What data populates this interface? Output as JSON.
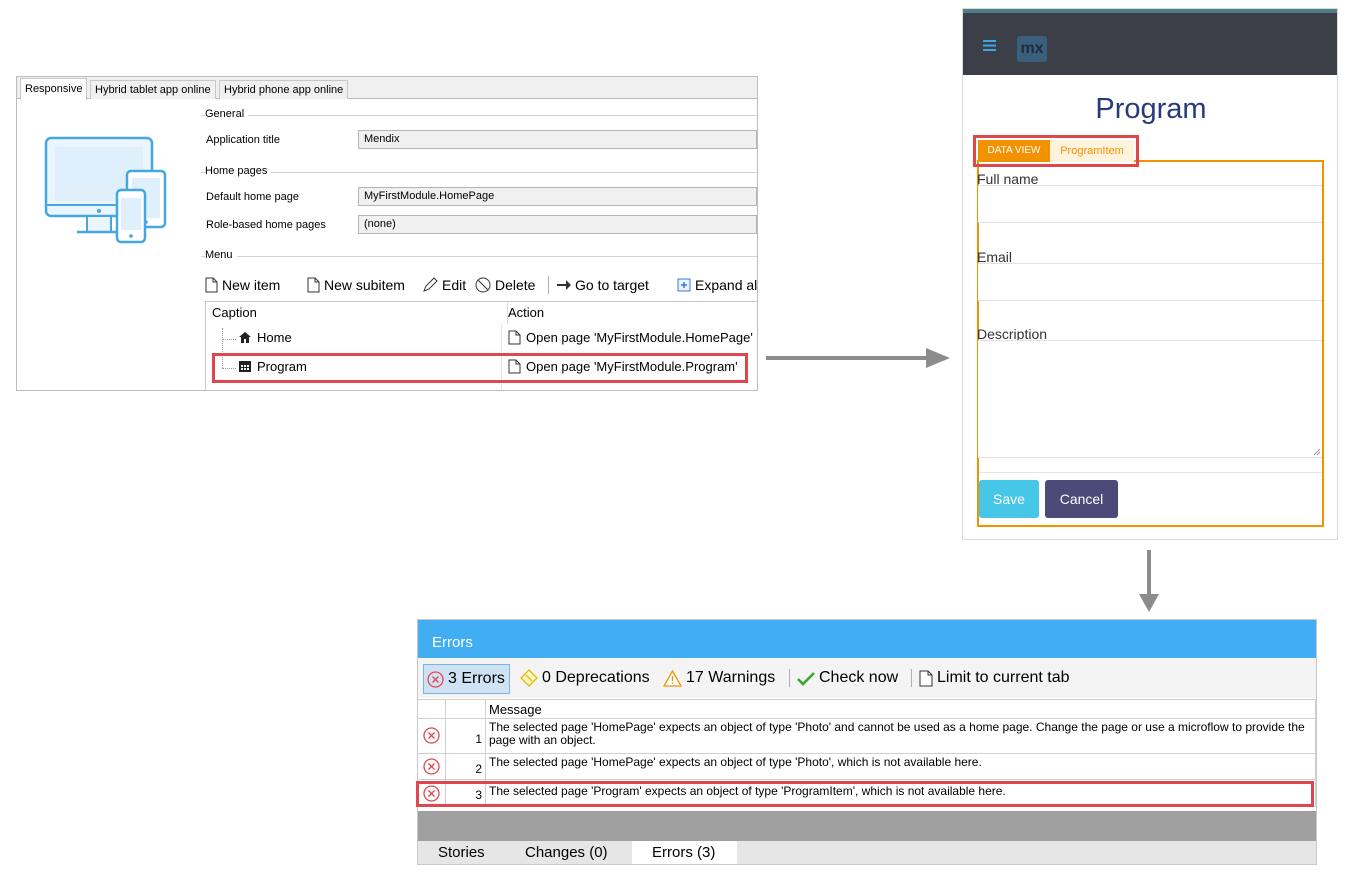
{
  "navigation": {
    "tabs": [
      "Responsive",
      "Hybrid tablet app online",
      "Hybrid phone app online"
    ],
    "general": {
      "label": "General",
      "app_title_label": "Application title",
      "app_title_value": "Mendix"
    },
    "home_pages": {
      "label": "Home pages",
      "default_label": "Default home page",
      "default_value": "MyFirstModule.HomePage",
      "role_label": "Role-based home pages",
      "role_value": "(none)"
    },
    "menu": {
      "label": "Menu",
      "toolbar": {
        "new_item": "New item",
        "new_subitem": "New subitem",
        "edit": "Edit",
        "delete": "Delete",
        "go_to_target": "Go to target",
        "expand_all": "Expand all"
      },
      "columns": [
        "Caption",
        "Action"
      ],
      "rows": [
        {
          "caption": "Home",
          "action": "Open page 'MyFirstModule.HomePage'"
        },
        {
          "caption": "Program",
          "action": "Open page 'MyFirstModule.Program'"
        }
      ]
    }
  },
  "preview": {
    "menu_icon": "hamburger-icon",
    "logo_text": "mx",
    "title": "Program",
    "dataview_tag": "DATA VIEW",
    "dataview_entity": "ProgramItem",
    "fields": [
      {
        "label": "Full name"
      },
      {
        "label": "Email"
      },
      {
        "label": "Description"
      }
    ],
    "save_label": "Save",
    "cancel_label": "Cancel",
    "colors": {
      "accent": "#f39200",
      "save": "#47c7e8",
      "cancel": "#4c4a78",
      "heading": "#273b7a"
    }
  },
  "errors": {
    "title": "Errors",
    "toolbar": {
      "errors": "3 Errors",
      "deprecations": "0 Deprecations",
      "warnings": "17 Warnings",
      "check_now": "Check now",
      "limit": "Limit to current tab"
    },
    "column_header": "Message",
    "rows": [
      {
        "num": "1",
        "message": "The selected page 'HomePage' expects an object of type 'Photo' and cannot be used as a home page. Change the page or use a microflow to provide the page with an object."
      },
      {
        "num": "2",
        "message": "The selected page 'HomePage' expects an object of type 'Photo', which is not available here."
      },
      {
        "num": "3",
        "message": "The selected page 'Program' expects an object of type 'ProgramItem', which is not available here."
      }
    ],
    "tabs": [
      "Stories",
      "Changes (0)",
      "Errors (3)"
    ],
    "colors": {
      "title_bar": "#41aef3",
      "error": "#e0474c"
    }
  }
}
